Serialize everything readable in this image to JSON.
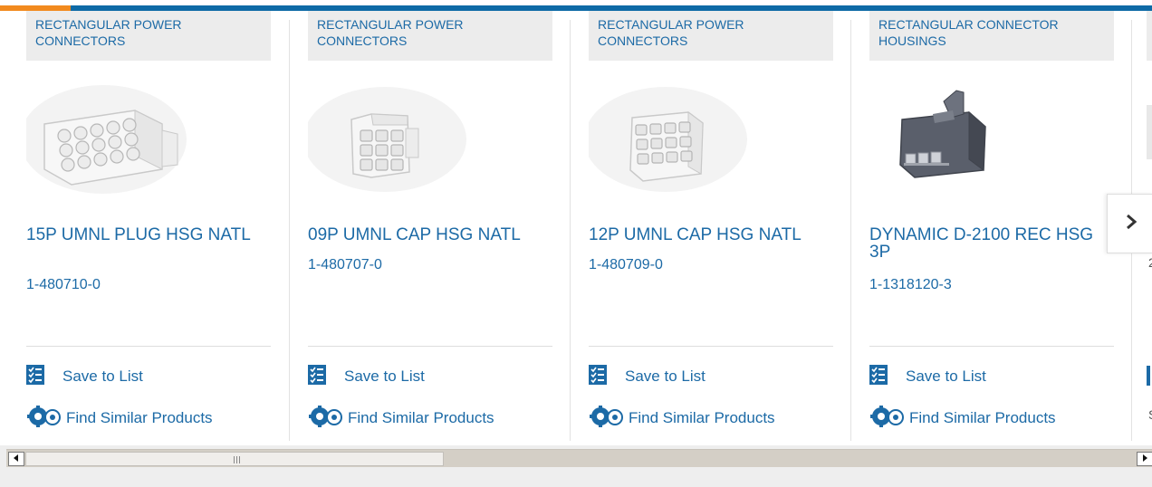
{
  "cards": [
    {
      "category": "RECTANGULAR POWER CONNECTORS",
      "title": "15P UMNL PLUG HSG NATL",
      "part_number": "1-480710-0",
      "image_icon": "white-15-pin-plug-housing",
      "save_label": "Save to List",
      "find_label": "Find Similar Products"
    },
    {
      "category": "RECTANGULAR POWER CONNECTORS",
      "title": "09P UMNL CAP HSG NATL",
      "part_number": "1-480707-0",
      "image_icon": "white-9-pin-cap-housing",
      "save_label": "Save to List",
      "find_label": "Find Similar Products"
    },
    {
      "category": "RECTANGULAR POWER CONNECTORS",
      "title": "12P UMNL CAP HSG NATL",
      "part_number": "1-480709-0",
      "image_icon": "white-12-pin-cap-housing",
      "save_label": "Save to List",
      "find_label": "Find Similar Products"
    },
    {
      "category": "RECTANGULAR CONNECTOR HOUSINGS",
      "title": "DYNAMIC D-2100 REC HSG 3P",
      "part_number": "1-1318120-3",
      "image_icon": "gray-3-pin-receptacle-housing",
      "save_label": "Save to List",
      "find_label": "Find Similar Products"
    }
  ],
  "partial_card": {
    "visible_glyph_1": "2",
    "visible_glyph_2": "S"
  },
  "icons": {
    "next": "chevron-right-icon",
    "save": "checklist-icon",
    "find": "gears-icon"
  },
  "colors": {
    "accent_blue": "#1c6aa6",
    "accent_orange": "#f28a1e",
    "category_bg": "#ececec"
  }
}
